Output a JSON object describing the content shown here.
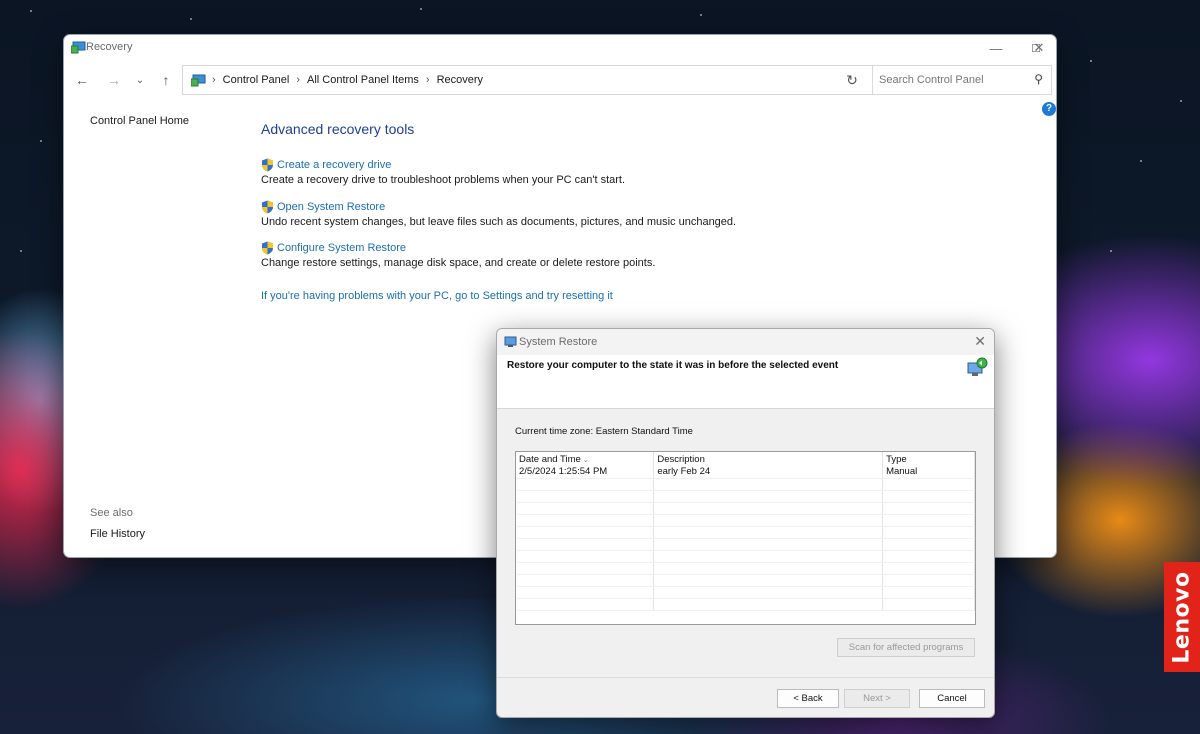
{
  "window": {
    "title": "Recovery",
    "search_placeholder": "Search Control Panel",
    "help_label": "?"
  },
  "breadcrumb": [
    "Control Panel",
    "All Control Panel Items",
    "Recovery"
  ],
  "left_pane": {
    "home_link": "Control Panel Home",
    "see_also_label": "See also",
    "file_history_link": "File History"
  },
  "main": {
    "title": "Advanced recovery tools",
    "tools": [
      {
        "link": "Create a recovery drive",
        "description": "Create a recovery drive to troubleshoot problems when your PC can't start."
      },
      {
        "link": "Open System Restore",
        "description": "Undo recent system changes, but leave files such as documents, pictures, and music unchanged."
      },
      {
        "link": "Configure System Restore",
        "description": "Change restore settings, manage disk space, and create or delete restore points."
      }
    ],
    "reset_link": "If you're having problems with your PC, go to Settings and try resetting it"
  },
  "dialog": {
    "title": "System Restore",
    "heading": "Restore your computer to the state it was in before the selected event",
    "timezone": "Current time zone: Eastern Standard Time",
    "columns": [
      "Date and Time",
      "Description",
      "Type"
    ],
    "rows": [
      [
        "2/5/2024 1:25:54 PM",
        "early Feb 24",
        "Manual"
      ]
    ],
    "scan_button": "Scan for affected programs",
    "back_button": "< Back",
    "next_button": "Next >",
    "cancel_button": "Cancel"
  },
  "brand": {
    "lenovo_text": "Lenovo",
    "lenovo_color": "#e2231a"
  },
  "colors": {
    "link": "#1a6fb4",
    "title": "#1c3f94",
    "help": "#1e78d7"
  }
}
